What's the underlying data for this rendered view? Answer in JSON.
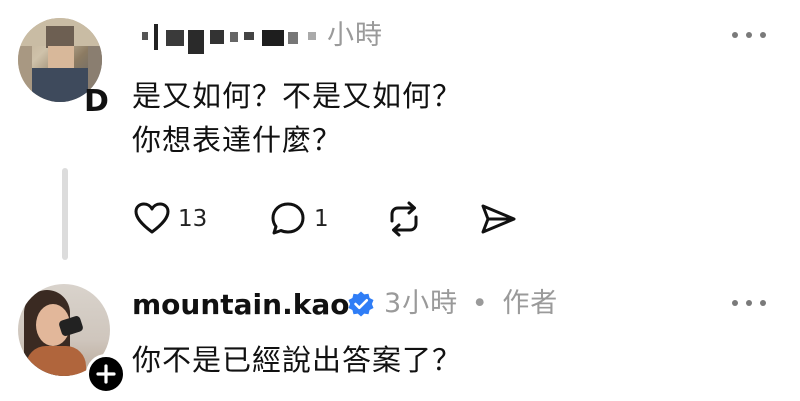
{
  "comment1": {
    "time": "小時",
    "lines": [
      "是又如何？不是又如何？",
      "你想表達什麼？"
    ],
    "badge": "D",
    "likes": "13",
    "replies": "1"
  },
  "comment2": {
    "username": "mountain.kao",
    "time": "3小時",
    "separator": "•",
    "role": "作者",
    "text": "你不是已經說出答案了？"
  },
  "icons": {
    "like": "heart-icon",
    "reply": "speech-bubble-icon",
    "repost": "repost-icon",
    "share": "send-icon",
    "more": "more-dots-icon",
    "verified": "verified-badge-icon",
    "follow": "plus-icon"
  },
  "colors": {
    "verified": "#2f7df6",
    "muted": "#9a9a9a"
  }
}
